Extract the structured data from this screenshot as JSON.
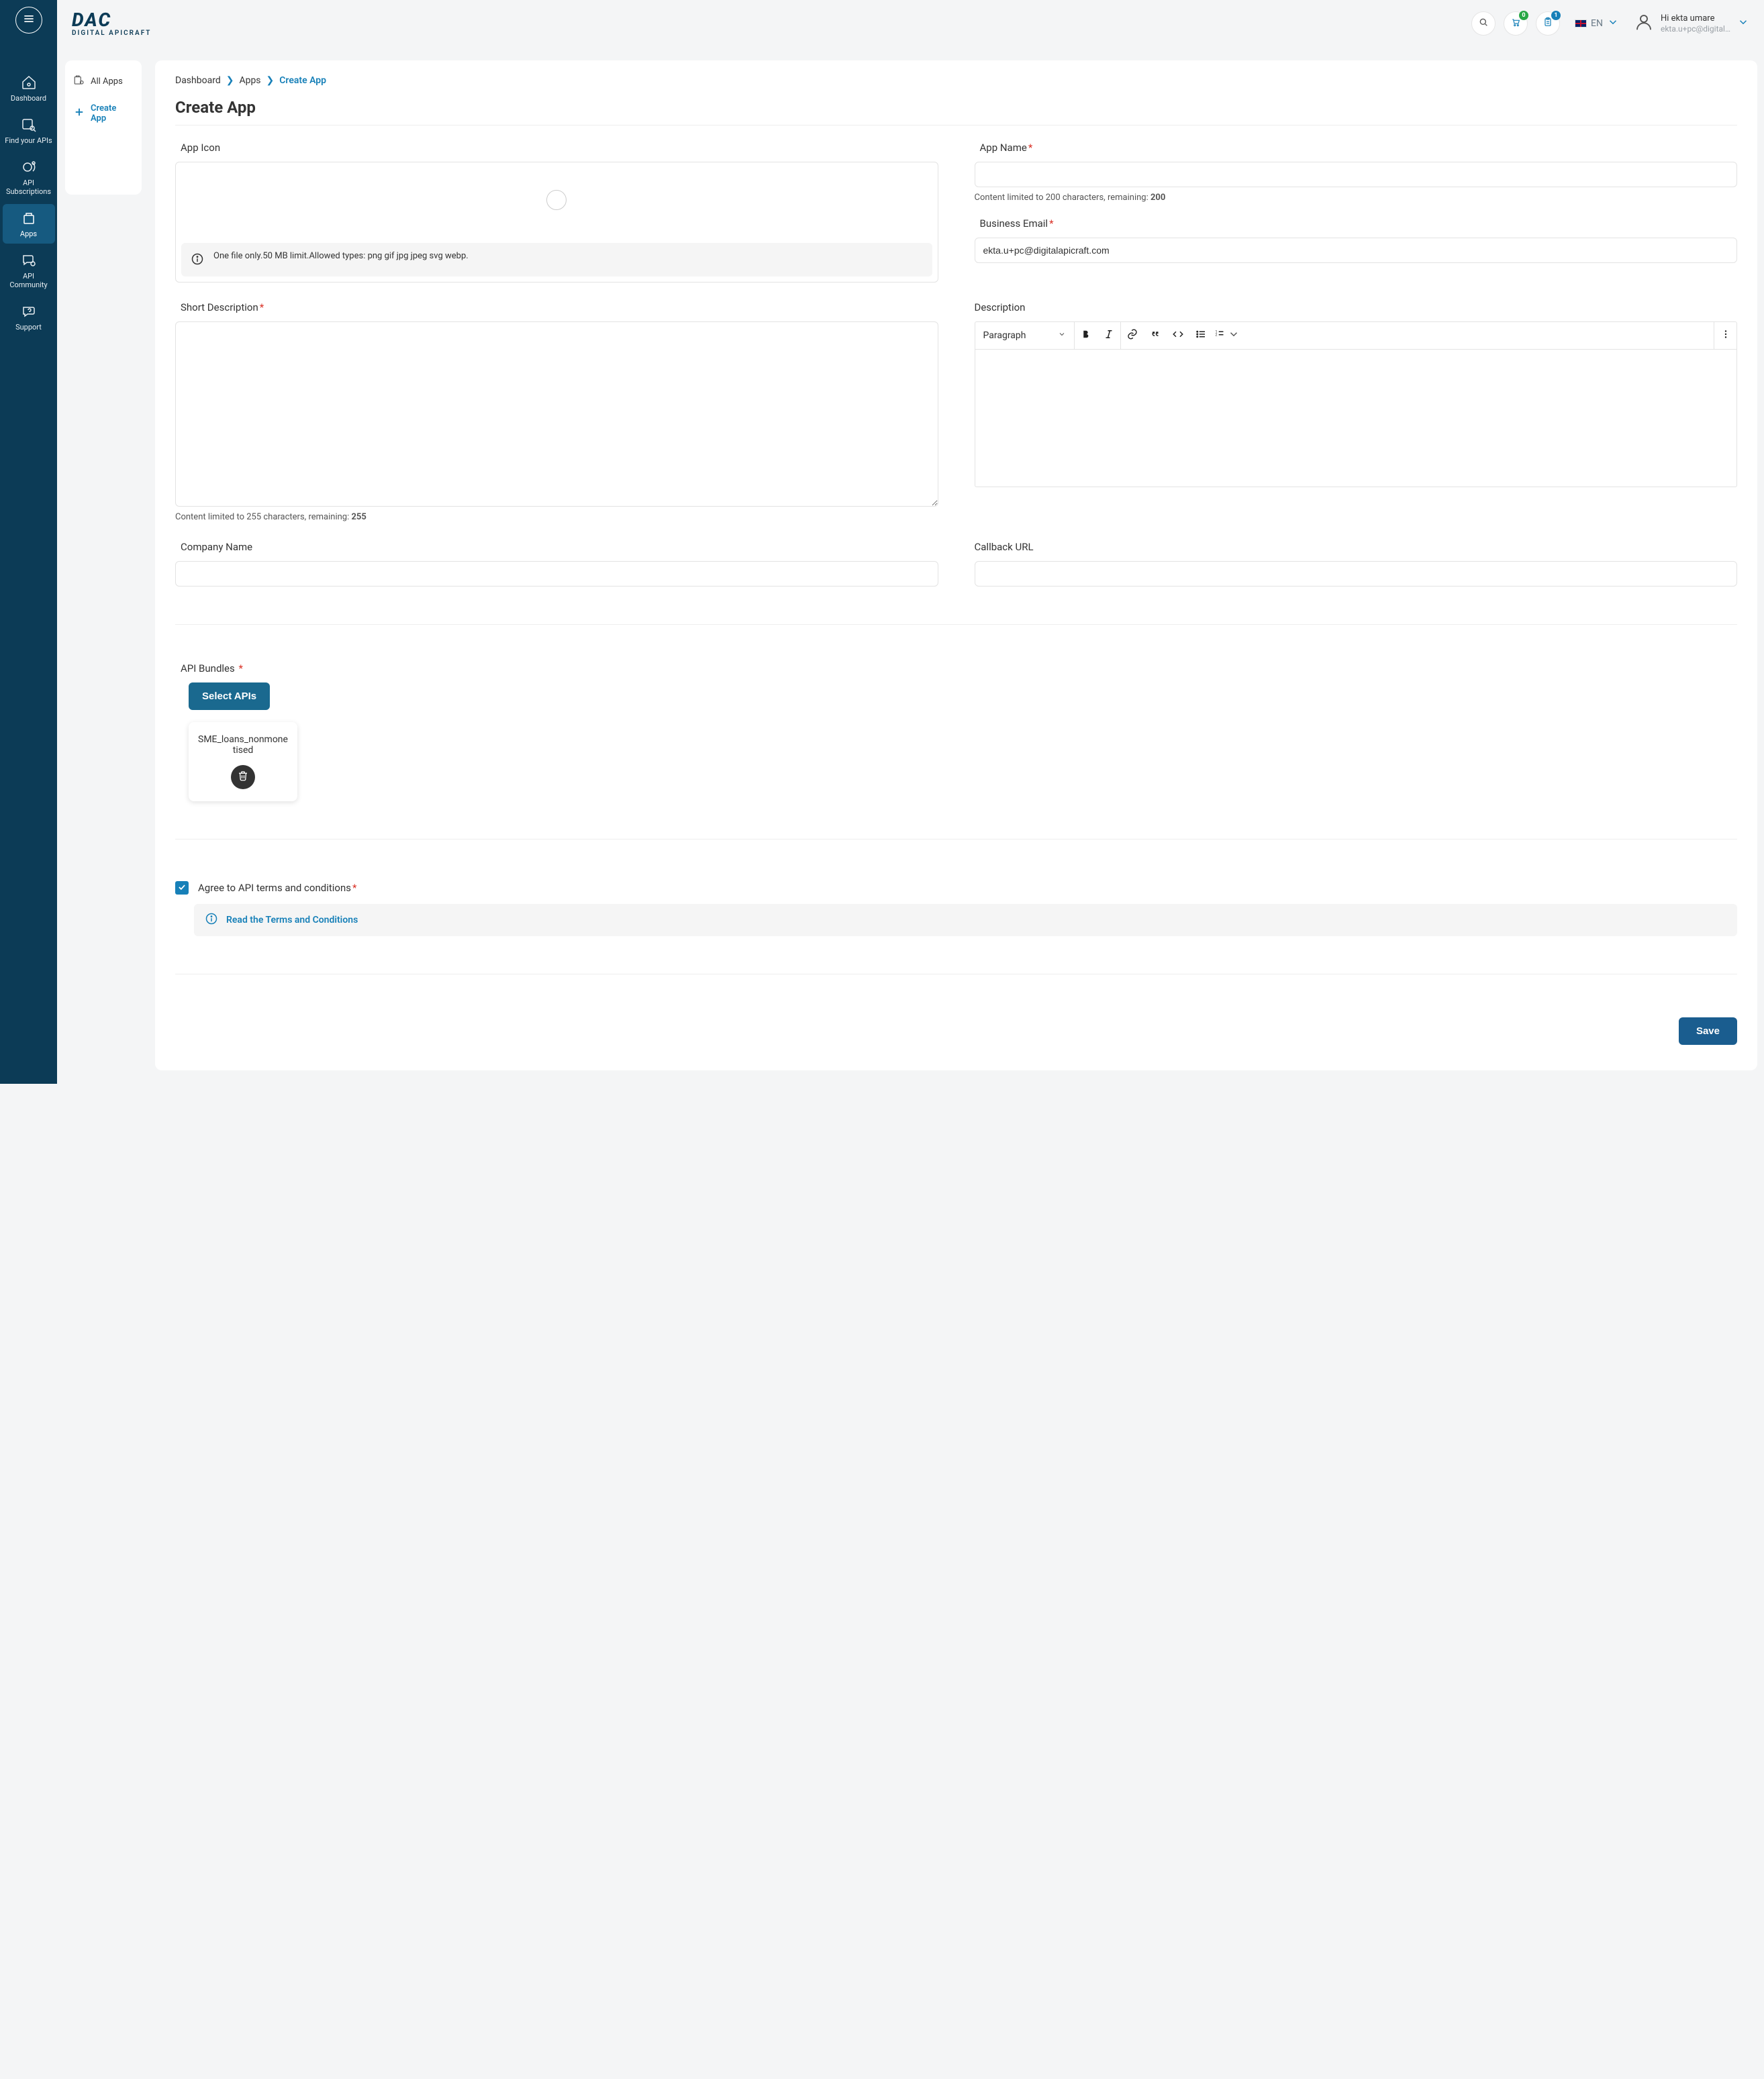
{
  "brand": {
    "mark": "DAC",
    "tagline": "DIGITAL APICRAFT"
  },
  "sidebar": {
    "items": [
      {
        "label": "Dashboard"
      },
      {
        "label": "Find your APIs"
      },
      {
        "label": "API Subscriptions"
      },
      {
        "label": "Apps"
      },
      {
        "label": "API Community"
      },
      {
        "label": "Support"
      }
    ]
  },
  "header": {
    "cart_badge": "0",
    "tasks_badge": "1",
    "lang": "EN",
    "greeting": "Hi ekta umare",
    "user_email": "ekta.u+pc@digital…"
  },
  "sidepanel": {
    "all_apps": "All Apps",
    "create_app": "Create App"
  },
  "breadcrumbs": {
    "b1": "Dashboard",
    "b2": "Apps",
    "b3": "Create App"
  },
  "page": {
    "title": "Create App"
  },
  "form": {
    "app_icon_label": "App Icon",
    "upload_info": "One file only.50 MB limit.Allowed types: png gif jpg jpeg svg webp.",
    "app_name_label": "App Name",
    "app_name_value": "",
    "app_name_hint_prefix": "Content limited to 200 characters, remaining: ",
    "app_name_hint_count": "200",
    "business_email_label": "Business Email",
    "business_email_value": "ekta.u+pc@digitalapicraft.com",
    "short_desc_label": "Short Description",
    "short_desc_value": "",
    "short_desc_hint_prefix": "Content limited to 255 characters, remaining: ",
    "short_desc_hint_count": "255",
    "description_label": "Description",
    "rte_style": "Paragraph",
    "company_label": "Company Name",
    "company_value": "",
    "callback_label": "Callback URL",
    "callback_value": "",
    "api_bundles_label": "API Bundles",
    "select_apis_btn": "Select APIs",
    "selected_api": "SME_loans_nonmonetised",
    "terms_label": "Agree to API terms and conditions",
    "terms_link": "Read the Terms and Conditions",
    "save_btn": "Save"
  }
}
